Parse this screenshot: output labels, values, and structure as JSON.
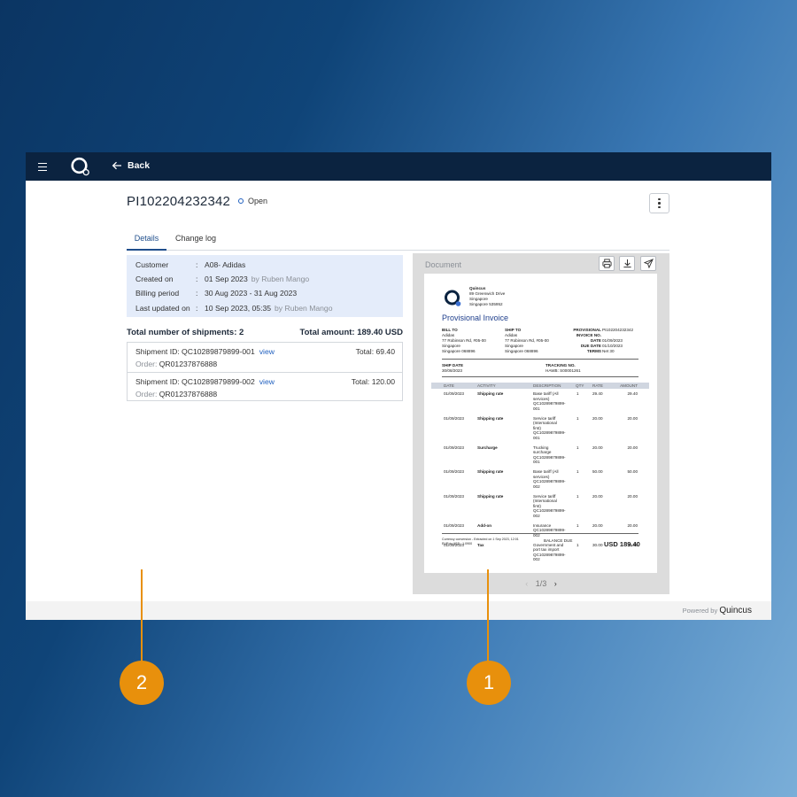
{
  "topbar": {
    "back_label": "Back"
  },
  "header": {
    "invoice_id": "PI102204232342",
    "status": "Open"
  },
  "tabs": [
    {
      "label": "Details"
    },
    {
      "label": "Change log"
    }
  ],
  "summary": [
    {
      "label": "Customer",
      "value": "A08- Adidas",
      "by": ""
    },
    {
      "label": "Created on",
      "value": "01 Sep 2023",
      "by": "by Ruben Mango"
    },
    {
      "label": "Billing period",
      "value": "30 Aug 2023 - 31 Aug 2023",
      "by": ""
    },
    {
      "label": "Last updated on",
      "value": "10 Sep 2023, 05:35",
      "by": "by Ruben Mango"
    }
  ],
  "totals": {
    "shipments": "Total number of shipments: 2",
    "amount": "Total amount: 189.40 USD"
  },
  "shipments": [
    {
      "id_prefix": "Shipment ID: QC10289879899-001",
      "view": "view",
      "total": "Total:  69.40",
      "order_label": "Order:",
      "order": "QR01237876888"
    },
    {
      "id_prefix": "Shipment ID: QC10289879899-002",
      "view": "view",
      "total": "Total:  120.00",
      "order_label": "Order:",
      "order": "QR01237876888"
    }
  ],
  "document": {
    "label": "Document",
    "pager": {
      "prev": "‹",
      "text": "1/3",
      "next": "›"
    },
    "invoice": {
      "company": "Quincus",
      "company_address": [
        "89 Greenwich Drive",
        "Singapore",
        "Singapore  535952"
      ],
      "title": "Provisional Invoice",
      "bill_to_label": "BILL TO",
      "bill_to": [
        "Adidas",
        "77 Robinson Rd, #05-00",
        "Singapore",
        "Singapore  068896"
      ],
      "ship_to_label": "SHIP TO",
      "ship_to": [
        "Adidas",
        "77 Robinson Rd, #05-00",
        "Singapore",
        "Singapore  068896"
      ],
      "meta_labels": [
        "PROVISIONAL",
        "INVOICE NO.",
        "DATE",
        "DUE DATE",
        "TERMS"
      ],
      "meta_values": [
        "PI102204232342",
        "",
        "01/09/2023",
        "01/10/2023",
        "Net 30"
      ],
      "ship_date_label": "SHIP DATE",
      "ship_date": "30/08/2023",
      "tracking_label": "TRACKING NO.",
      "tracking": "HAWB: S00001261",
      "columns": [
        "DATE",
        "ACTIVITY",
        "DESCRIPTION",
        "QTY",
        "RATE",
        "AMOUNT"
      ],
      "rows": [
        {
          "date": "01/09/2023",
          "activity": "Shipping rate",
          "desc": [
            "Base tariff (All",
            "services)",
            "QC10289879899-",
            "001"
          ],
          "qty": "1",
          "rate": "29.40",
          "amount": "29.40"
        },
        {
          "date": "01/09/2023",
          "activity": "Shipping rate",
          "desc": [
            "Service tariff",
            "(International",
            "first)",
            "QC10289879899-",
            "001"
          ],
          "qty": "1",
          "rate": "20.00",
          "amount": "20.00"
        },
        {
          "date": "01/09/2023",
          "activity": "Surcharge",
          "desc": [
            "Trucking",
            "surcharge",
            "QC10289879899-",
            "001"
          ],
          "qty": "1",
          "rate": "20.00",
          "amount": "20.00"
        },
        {
          "date": "01/09/2023",
          "activity": "Shipping rate",
          "desc": [
            "Base tariff (All",
            "services)",
            "QC10289879899-",
            "002"
          ],
          "qty": "1",
          "rate": "50.00",
          "amount": "50.00"
        },
        {
          "date": "01/09/2023",
          "activity": "Shipping rate",
          "desc": [
            "Service tariff",
            "(International",
            "first)",
            "QC10289879899-",
            "002"
          ],
          "qty": "1",
          "rate": "20.00",
          "amount": "20.00"
        },
        {
          "date": "01/09/2023",
          "activity": "Add-on",
          "desc": [
            "Insurance",
            "QC10289879899-",
            "002"
          ],
          "qty": "1",
          "rate": "20.00",
          "amount": "20.00"
        },
        {
          "date": "01/09/2023",
          "activity": "Tax",
          "desc": [
            "Government and",
            "port tax import",
            "QC10289879899-",
            "002"
          ],
          "qty": "1",
          "rate": "30.00",
          "amount": "30.00"
        }
      ],
      "footnote": [
        "Currency conversion - Extracted on 1 Sep 2023, 12:01",
        "EUR to USD : 1.0900"
      ],
      "balance_label": "BALANCE DUE",
      "balance": "USD 189.40"
    }
  },
  "footer": {
    "powered_by": "Powered by",
    "brand": "Quincus"
  },
  "callouts": [
    {
      "label": "2"
    },
    {
      "label": "1"
    }
  ],
  "colors": {
    "topbar": "#0b2340",
    "accent": "#1f4e8c",
    "link": "#1f5fbf",
    "callout": "#e8900c",
    "summary_bg": "#e4ecfa"
  }
}
